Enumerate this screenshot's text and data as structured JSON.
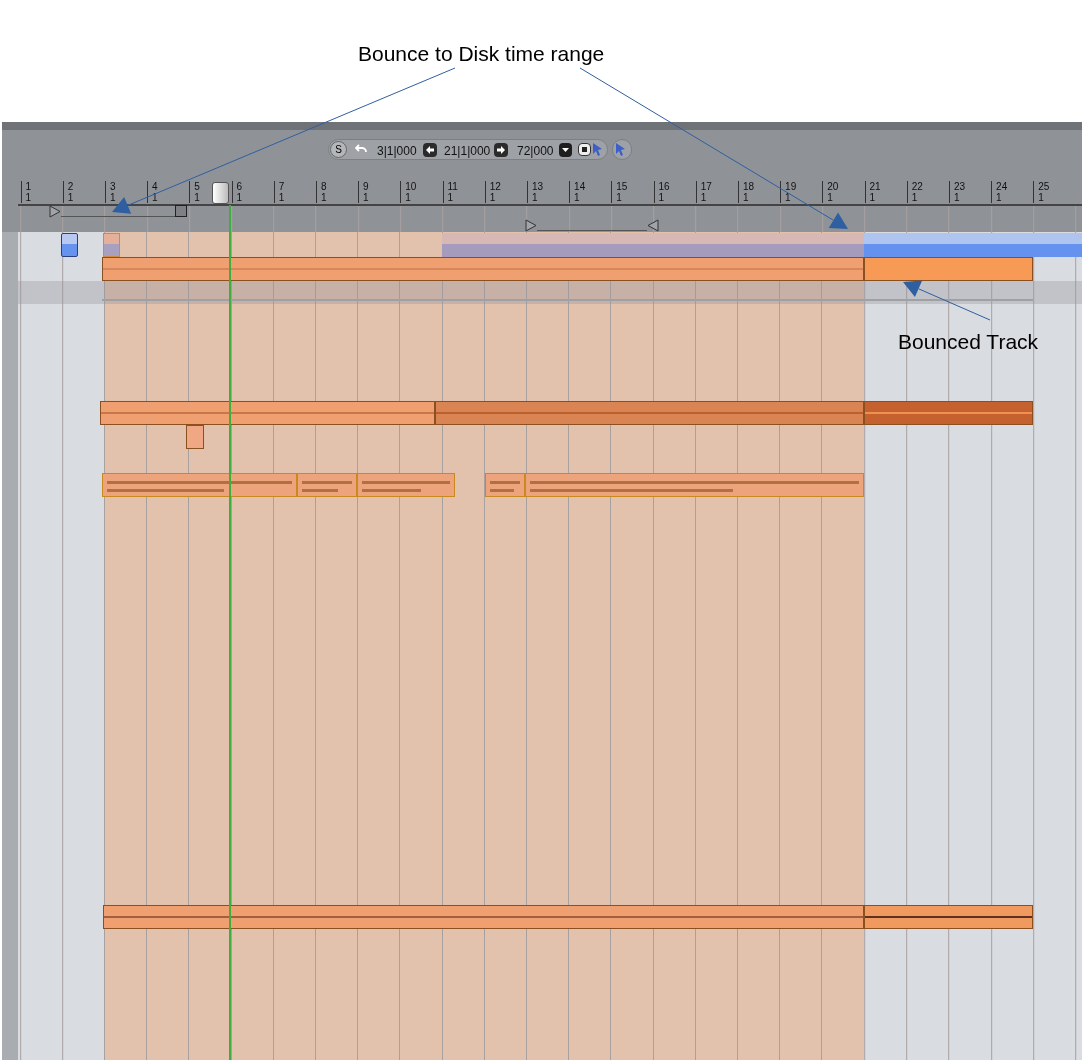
{
  "annotations": [
    {
      "text": "Bounce to Disk time range"
    },
    {
      "text": "Bounced Track"
    }
  ],
  "toolbar": {
    "solo": "S",
    "start": "3|1|000",
    "end": "21|1|000",
    "length": "72|000"
  },
  "ruler": [
    {
      "bar": "1",
      "beat": "1"
    },
    {
      "bar": "2",
      "beat": "1"
    },
    {
      "bar": "3",
      "beat": "1"
    },
    {
      "bar": "4",
      "beat": "1"
    },
    {
      "bar": "5",
      "beat": "1"
    },
    {
      "bar": "6",
      "beat": "1"
    },
    {
      "bar": "7",
      "beat": "1"
    },
    {
      "bar": "8",
      "beat": "1"
    },
    {
      "bar": "9",
      "beat": "1"
    },
    {
      "bar": "10",
      "beat": "1"
    },
    {
      "bar": "11",
      "beat": "1"
    },
    {
      "bar": "12",
      "beat": "1"
    },
    {
      "bar": "13",
      "beat": "1"
    },
    {
      "bar": "14",
      "beat": "1"
    },
    {
      "bar": "15",
      "beat": "1"
    },
    {
      "bar": "16",
      "beat": "1"
    },
    {
      "bar": "17",
      "beat": "1"
    },
    {
      "bar": "18",
      "beat": "1"
    },
    {
      "bar": "19",
      "beat": "1"
    },
    {
      "bar": "20",
      "beat": "1"
    },
    {
      "bar": "21",
      "beat": "1"
    },
    {
      "bar": "22",
      "beat": "1"
    },
    {
      "bar": "23",
      "beat": "1"
    },
    {
      "bar": "24",
      "beat": "1"
    },
    {
      "bar": "25",
      "beat": "1"
    }
  ]
}
